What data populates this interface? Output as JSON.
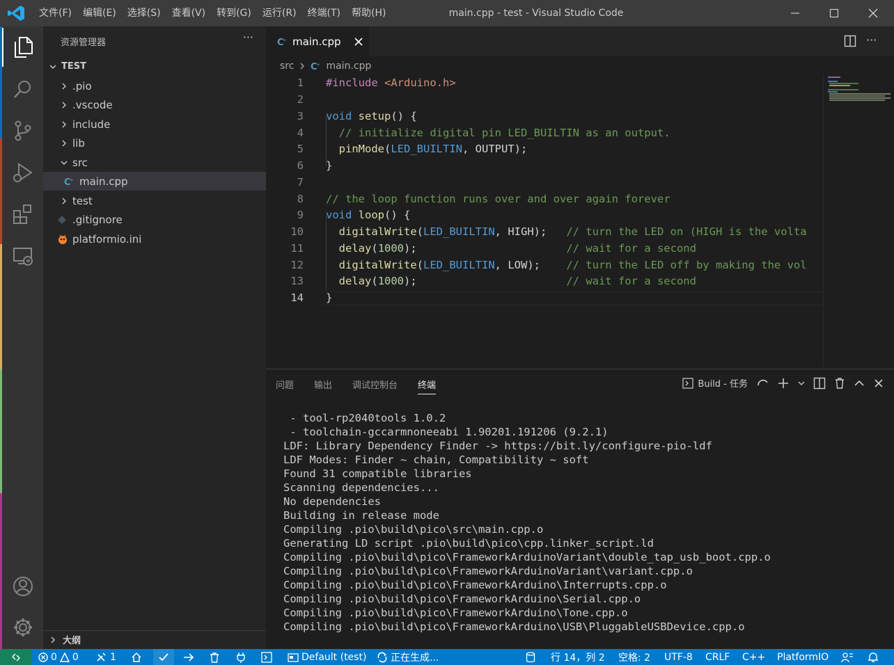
{
  "titlebar": {
    "menu": [
      "文件(F)",
      "编辑(E)",
      "选择(S)",
      "查看(V)",
      "转到(G)",
      "运行(R)",
      "终端(T)",
      "帮助(H)"
    ],
    "title": "main.cpp - test - Visual Studio Code"
  },
  "sidebar": {
    "title": "资源管理器",
    "more": "···",
    "root": "TEST",
    "items": [
      ".pio",
      ".vscode",
      "include",
      "lib",
      "src",
      "main.cpp",
      "test",
      ".gitignore",
      "platformio.ini"
    ],
    "outline": "大纲"
  },
  "editor": {
    "tab": "main.cpp",
    "breadcrumb": [
      "src",
      "main.cpp"
    ],
    "line_numbers": [
      "1",
      "2",
      "3",
      "4",
      "5",
      "6",
      "7",
      "8",
      "9",
      "10",
      "11",
      "12",
      "13",
      "14"
    ],
    "current_line": 14
  },
  "panel": {
    "tabs": [
      "问题",
      "输出",
      "调试控制台",
      "终端"
    ],
    "active_tab": "终端",
    "task": "Build - 任务",
    "terminal_lines": [
      " - tool-rp2040tools 1.0.2",
      " - toolchain-gccarmnoneeabi 1.90201.191206 (9.2.1)",
      "LDF: Library Dependency Finder -> https://bit.ly/configure-pio-ldf",
      "LDF Modes: Finder ~ chain, Compatibility ~ soft",
      "Found 31 compatible libraries",
      "Scanning dependencies...",
      "No dependencies",
      "Building in release mode",
      "Compiling .pio\\build\\pico\\src\\main.cpp.o",
      "Generating LD script .pio\\build\\pico\\cpp.linker_script.ld",
      "Compiling .pio\\build\\pico\\FrameworkArduinoVariant\\double_tap_usb_boot.cpp.o",
      "Compiling .pio\\build\\pico\\FrameworkArduinoVariant\\variant.cpp.o",
      "Compiling .pio\\build\\pico\\FrameworkArduino\\Interrupts.cpp.o",
      "Compiling .pio\\build\\pico\\FrameworkArduino\\Serial.cpp.o",
      "Compiling .pio\\build\\pico\\FrameworkArduino\\Tone.cpp.o",
      "Compiling .pio\\build\\pico\\FrameworkArduino\\USB\\PluggableUSBDevice.cpp.o"
    ]
  },
  "statusbar": {
    "errors": "0",
    "warnings": "0",
    "tools": "1",
    "env": "Default (test)",
    "building": "正在生成...",
    "position": "行 14，列 2",
    "spaces": "空格: 2",
    "encoding": "UTF-8",
    "eol": "CRLF",
    "language": "C++",
    "platformio": "PlatformIO"
  },
  "colors": {
    "statusbar": "#007acc",
    "remote": "#16825d",
    "titlebar": "#3c3c3c",
    "sidebar": "#252526",
    "editor": "#1e1e1e"
  }
}
